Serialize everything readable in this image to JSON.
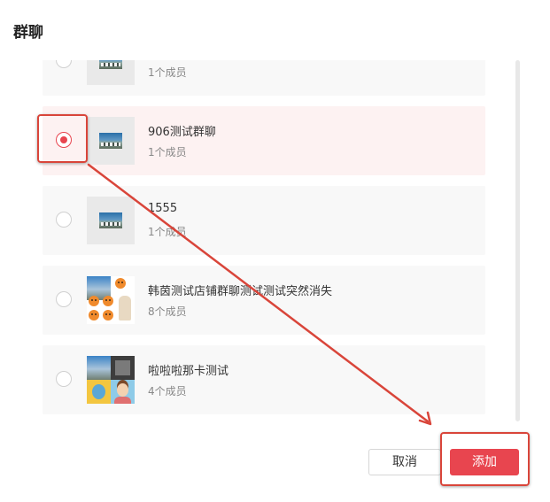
{
  "header": {
    "title": "群聊"
  },
  "groups": [
    {
      "name": "",
      "count": "1个成员",
      "selected": false
    },
    {
      "name": "906测试群聊",
      "count": "1个成员",
      "selected": true
    },
    {
      "name": "1555",
      "count": "1个成员",
      "selected": false
    },
    {
      "name": "韩茵测试店铺群聊测试测试突然消失",
      "count": "8个成员",
      "selected": false
    },
    {
      "name": "啦啦啦那卡测试",
      "count": "4个成员",
      "selected": false
    }
  ],
  "actions": {
    "cancel_label": "取消",
    "add_label": "添加"
  },
  "colors": {
    "accent": "#e8454f",
    "annotation": "#d9453a",
    "selected_row_bg": "#fdf2f2"
  }
}
